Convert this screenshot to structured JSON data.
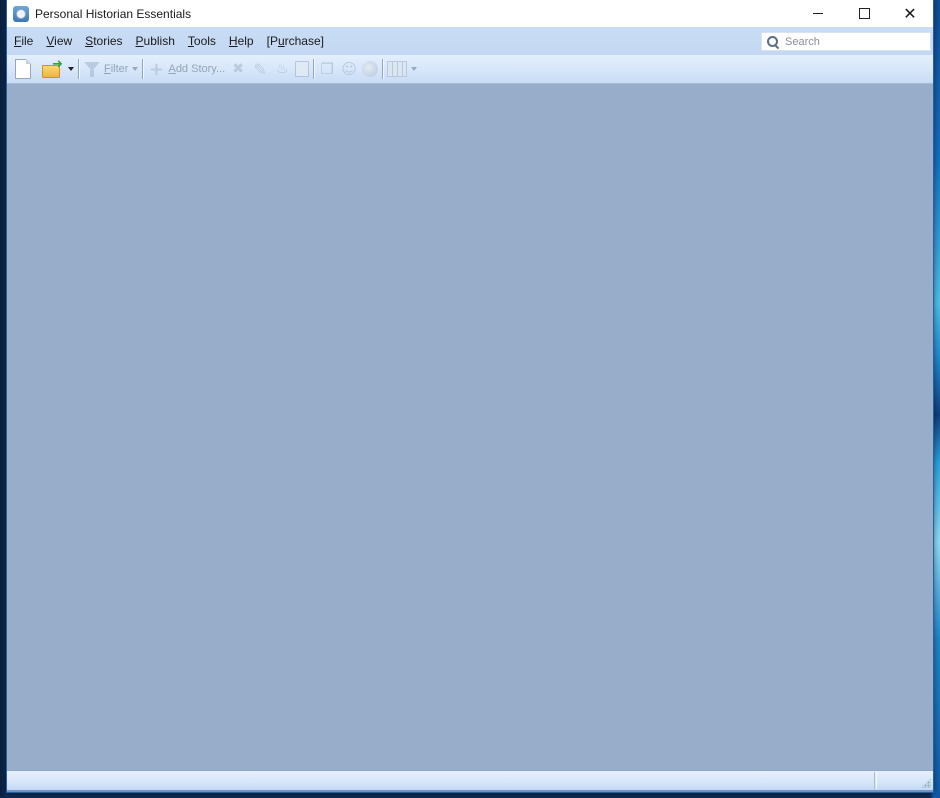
{
  "window": {
    "title": "Personal Historian Essentials",
    "caption_buttons": {
      "minimize": "–",
      "maximize": "□",
      "close": "✕"
    }
  },
  "menubar": {
    "items": [
      {
        "label": "File",
        "accel": "F",
        "rest": "ile"
      },
      {
        "label": "View",
        "accel": "V",
        "rest": "iew"
      },
      {
        "label": "Stories",
        "accel": "S",
        "rest": "tories"
      },
      {
        "label": "Publish",
        "accel": "P",
        "rest": "ublish"
      },
      {
        "label": "Tools",
        "accel": "T",
        "rest": "ools"
      },
      {
        "label": "Help",
        "accel": "H",
        "rest": "elp"
      },
      {
        "label": "[Purchase]",
        "pre": "[P",
        "accel": "u",
        "rest": "rchase]"
      }
    ]
  },
  "search": {
    "placeholder": "Search",
    "value": ""
  },
  "toolbar": {
    "new_icon": "new-document-icon",
    "open_icon": "open-folder-icon",
    "filter_label": "Filter",
    "filter_accel": "F",
    "filter_rest": "ilter",
    "add_story_label": "Add Story...",
    "add_story_accel": "A",
    "add_story_rest": "dd Story...",
    "icons": {
      "delete": "✖",
      "edit": "✎",
      "cake": "♨",
      "book": "❒",
      "person": "☺"
    },
    "enabled": {
      "new": true,
      "open": true,
      "filter": false,
      "add_story": false,
      "delete": false,
      "edit": false,
      "birthday": false,
      "calendar": false,
      "book": false,
      "person": false,
      "globe": false,
      "columns": false
    }
  },
  "statusbar": {
    "text": "",
    "right_text": ""
  },
  "colors": {
    "content_background": "#98adc9",
    "menubar_background": "#c9dcf5",
    "toolbar_background": "#d6e6fa",
    "disabled_text": "#93a4b9"
  }
}
